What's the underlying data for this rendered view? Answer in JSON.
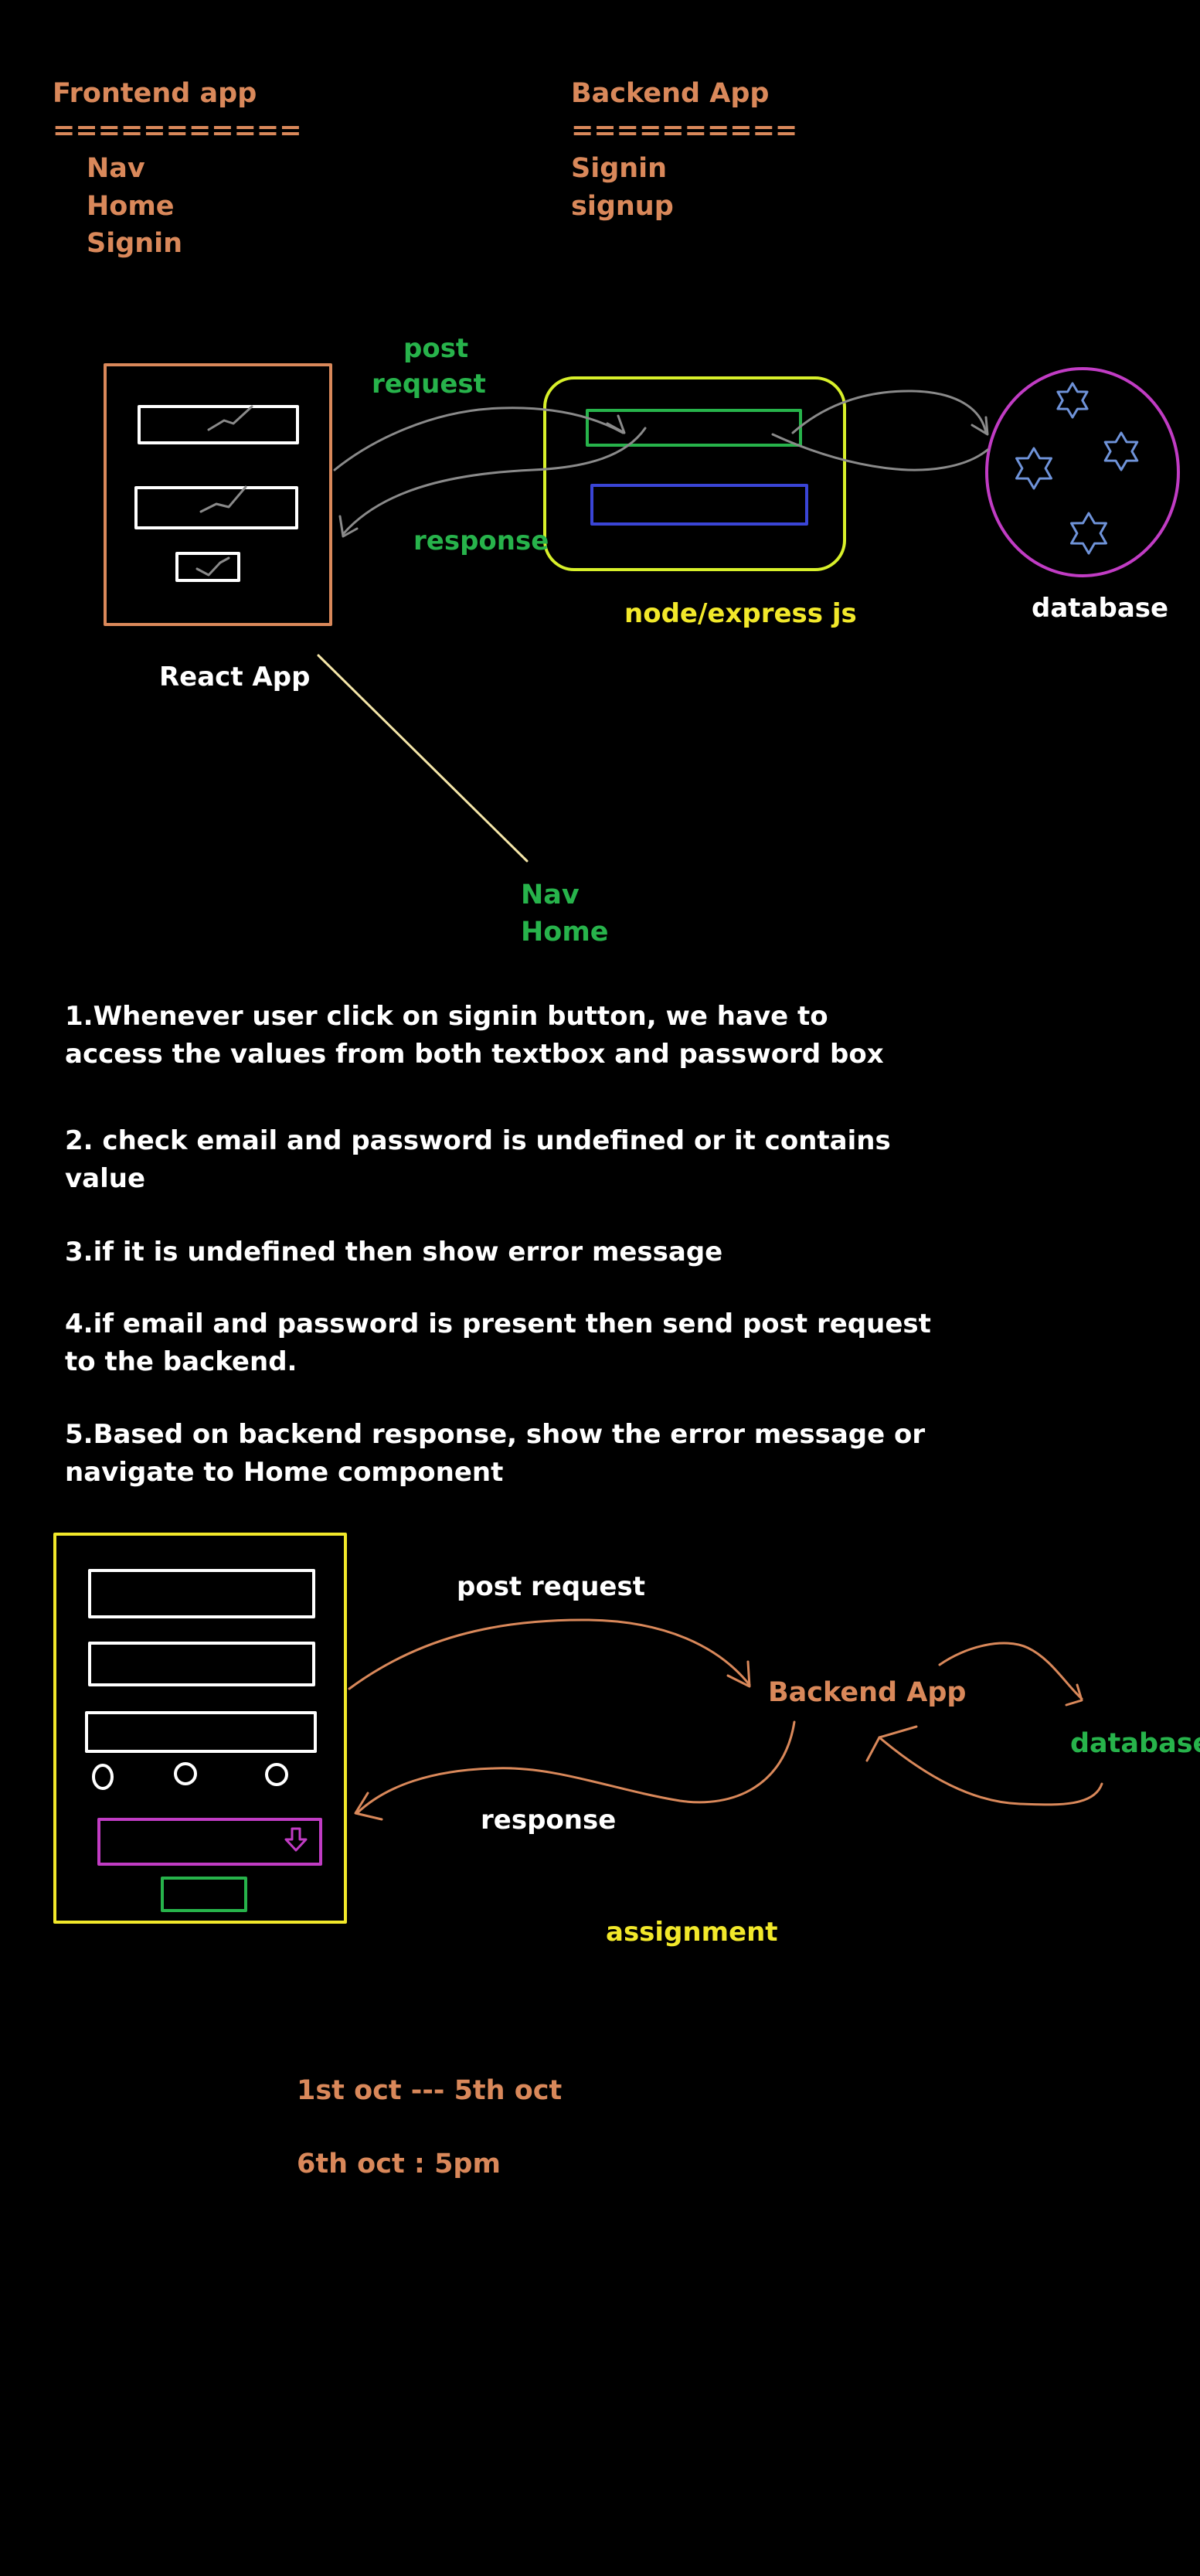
{
  "frontend": {
    "title": "Frontend app",
    "underline": "===========",
    "items": [
      "Nav",
      "Home",
      "Signin"
    ]
  },
  "backend": {
    "title": "Backend App",
    "underline": "==========",
    "items": [
      "Signin",
      "signup"
    ]
  },
  "diagram1": {
    "post_label_line1": "post",
    "post_label_line2": "request",
    "response_label": "response",
    "server_label": "node/express js",
    "database_label": "database",
    "react_label": "React App",
    "nav_label": "Nav",
    "home_label": "Home"
  },
  "notes": [
    "1.Whenever user click on signin button, we have to\naccess the values from both textbox and password box",
    "2. check email and password is undefined or it contains\nvalue",
    "3.if it is undefined then show error message",
    "4.if email and password is present then send post request\nto the backend.",
    "5.Based on backend response, show the error message or\nnavigate to Home component"
  ],
  "diagram2": {
    "post_label": "post request",
    "backend_label": "Backend App",
    "database_label": "database",
    "response_label": "response",
    "assignment_label": "assignment"
  },
  "schedule": {
    "dates": "1st oct --- 5th oct",
    "deadline": "6th oct : 5pm"
  },
  "colors": {
    "background": "#000000",
    "orange": "#d9885a",
    "green": "#27b34b",
    "yellow": "#f2e82a",
    "lime": "#d8f02a",
    "magenta": "#c13cc4",
    "blue": "#3a45d6",
    "star_blue": "#6f93d9",
    "gray": "#8a8a8a",
    "cream": "#f5e6a8"
  }
}
